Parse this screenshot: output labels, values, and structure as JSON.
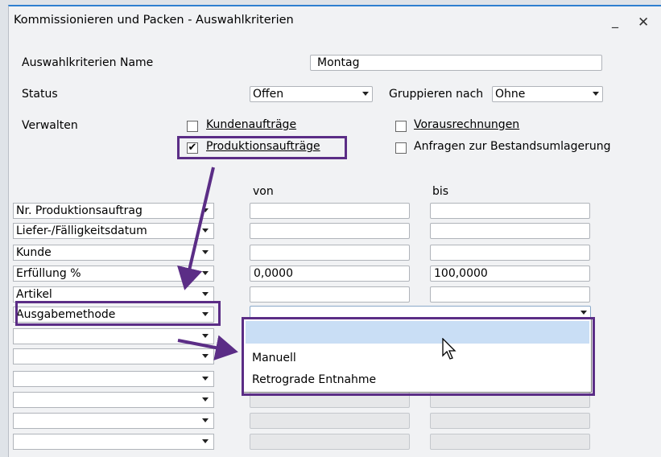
{
  "window": {
    "title": "Kommissionieren und Packen - Auswahlkriterien",
    "minimize_glyph": "_",
    "close_glyph": "✕"
  },
  "form": {
    "name_label": "Auswahlkriterien Name",
    "name_value": "Montag",
    "status_label": "Status",
    "status_value": "Offen",
    "group_label": "Gruppieren nach",
    "group_value": "Ohne",
    "manage_label": "Verwalten",
    "manage_options": [
      {
        "label": "Kundenaufträge",
        "checked": false
      },
      {
        "label": "Produktionsaufträge",
        "checked": true
      },
      {
        "label": "Vorausrechnungen",
        "checked": false
      },
      {
        "label": "Anfragen zur Bestandsumlagerung",
        "checked": false
      }
    ],
    "check_glyph": "✔"
  },
  "criteria": {
    "from_header": "von",
    "to_header": "bis",
    "rows": [
      {
        "field": "Nr. Produktionsauftrag",
        "from": "",
        "to": ""
      },
      {
        "field": "Liefer-/Fälligkeitsdatum",
        "from": "",
        "to": ""
      },
      {
        "field": "Kunde",
        "from": "",
        "to": ""
      },
      {
        "field": "Erfüllung %",
        "from": "0,0000",
        "to": "100,0000"
      },
      {
        "field": "Artikel",
        "from": "",
        "to": ""
      },
      {
        "field": "Ausgabemethode",
        "from": "",
        "to": ""
      },
      {
        "field": "",
        "from": "",
        "to": ""
      },
      {
        "field": "",
        "from": "",
        "to": ""
      },
      {
        "field": "",
        "from": "",
        "to": ""
      },
      {
        "field": "",
        "from": "",
        "to": ""
      },
      {
        "field": "",
        "from": "",
        "to": ""
      },
      {
        "field": "",
        "from": "",
        "to": ""
      }
    ]
  },
  "dropdown_popup": {
    "options": [
      "",
      "Manuell",
      "Retrograde Entnahme"
    ],
    "highlighted_index": 0
  },
  "annotation": {
    "color": "#5b2d86"
  }
}
